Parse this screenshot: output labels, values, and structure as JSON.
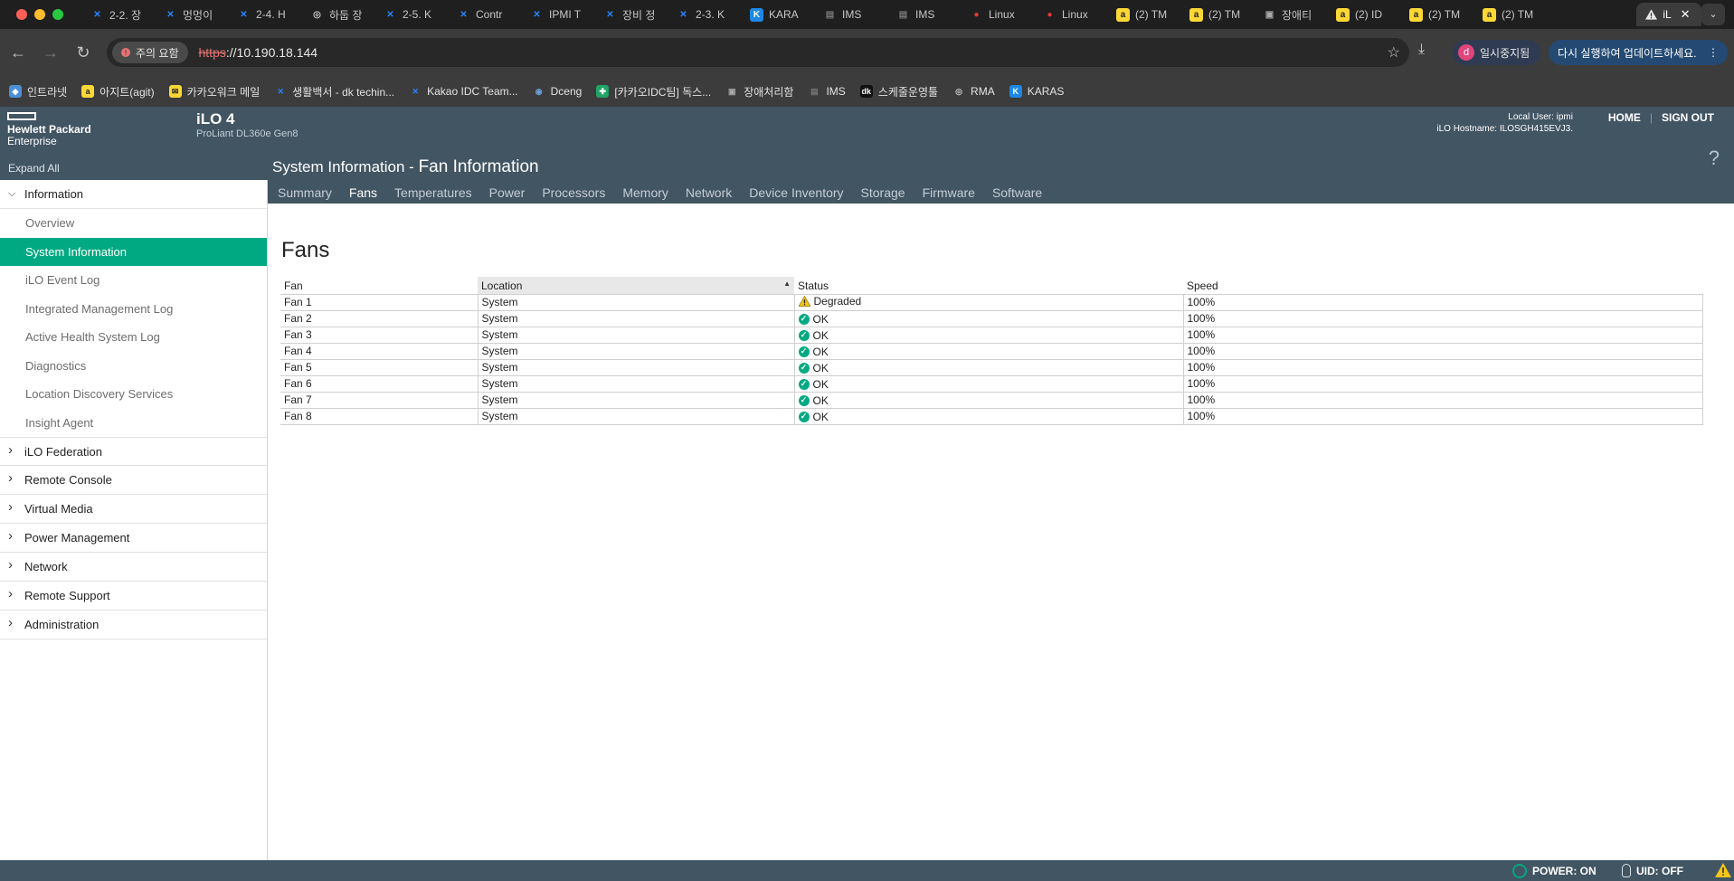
{
  "browser": {
    "tabs": [
      {
        "label": "2-2. 장",
        "icon": "confluence-icon",
        "color": "#2684ff"
      },
      {
        "label": "멍멍이",
        "icon": "confluence-icon",
        "color": "#2684ff"
      },
      {
        "label": "2-4. H",
        "icon": "confluence-icon",
        "color": "#2684ff"
      },
      {
        "label": "하둡 장",
        "icon": "globe-icon",
        "color": "#c7c7c7"
      },
      {
        "label": "2-5. K",
        "icon": "confluence-icon",
        "color": "#2684ff"
      },
      {
        "label": "Contr",
        "icon": "confluence-icon",
        "color": "#2684ff"
      },
      {
        "label": "IPMI T",
        "icon": "confluence-icon",
        "color": "#2684ff"
      },
      {
        "label": "장비 정",
        "icon": "confluence-icon",
        "color": "#2684ff"
      },
      {
        "label": "2-3. K",
        "icon": "confluence-icon",
        "color": "#2684ff"
      },
      {
        "label": "KARA",
        "icon": "k-icon",
        "color": "#1e88e5"
      },
      {
        "label": "IMS",
        "icon": "server-icon",
        "color": "#777"
      },
      {
        "label": "IMS",
        "icon": "server-icon",
        "color": "#777"
      },
      {
        "label": "Linux",
        "icon": "red-circle-icon",
        "color": "#e53935"
      },
      {
        "label": "Linux",
        "icon": "red-circle-icon",
        "color": "#e53935"
      },
      {
        "label": "(2) TM",
        "icon": "agit-icon",
        "color": "#fdd835"
      },
      {
        "label": "(2) TM",
        "icon": "agit-icon",
        "color": "#fdd835"
      },
      {
        "label": "장애티",
        "icon": "doc-icon",
        "color": "#aaa"
      },
      {
        "label": "(2) ID",
        "icon": "agit-icon",
        "color": "#fdd835"
      },
      {
        "label": "(2) TM",
        "icon": "agit-icon",
        "color": "#fdd835"
      },
      {
        "label": "(2) TM",
        "icon": "agit-icon",
        "color": "#fdd835"
      }
    ],
    "active_tab_label": "iL",
    "security_chip": "주의 요함",
    "url_protocol": "https",
    "url_rest": "://10.190.18.144",
    "profile_initial": "d",
    "profile_label": "일시중지됨",
    "update_label": "다시 실행하여 업데이트하세요.",
    "bookmarks": [
      {
        "label": "인트라넷",
        "icon": "intranet-icon",
        "color": "#4a8fd8"
      },
      {
        "label": "아지트(agit)",
        "icon": "agit-icon",
        "color": "#fdd835"
      },
      {
        "label": "카카오워크 메일",
        "icon": "mail-icon",
        "color": "#fdd835"
      },
      {
        "label": "생활백서 - dk techin...",
        "icon": "confluence-icon",
        "color": "#2684ff"
      },
      {
        "label": "Kakao IDC Team...",
        "icon": "confluence-icon",
        "color": "#2684ff"
      },
      {
        "label": "Dceng",
        "icon": "dceng-icon",
        "color": "#6aa0d8"
      },
      {
        "label": "[카카오IDC팀] 독스...",
        "icon": "sheets-icon",
        "color": "#21a366"
      },
      {
        "label": "장애처리함",
        "icon": "doc-icon",
        "color": "#aaa"
      },
      {
        "label": "IMS",
        "icon": "server-icon",
        "color": "#777"
      },
      {
        "label": "스케줄운영툴",
        "icon": "dk-icon",
        "color": "#111"
      },
      {
        "label": "RMA",
        "icon": "globe-icon",
        "color": "#c7c7c7"
      },
      {
        "label": "KARAS",
        "icon": "k-icon",
        "color": "#1e88e5"
      }
    ]
  },
  "ilo": {
    "brand_line1": "Hewlett Packard",
    "brand_line2": "Enterprise",
    "title": "iLO 4",
    "model": "ProLiant DL360e Gen8",
    "local_user": "Local User: ipmi",
    "hostname": "iLO Hostname: ILOSGH415EVJ3.",
    "home": "HOME",
    "sign_out": "SIGN OUT",
    "expand_all": "Expand All",
    "heading_prefix": "System Information - ",
    "heading_main": "Fan Information",
    "help": "?",
    "subtabs": [
      "Summary",
      "Fans",
      "Temperatures",
      "Power",
      "Processors",
      "Memory",
      "Network",
      "Device Inventory",
      "Storage",
      "Firmware",
      "Software"
    ],
    "active_subtab": "Fans"
  },
  "sidebar": {
    "information_label": "Information",
    "information_items": [
      "Overview",
      "System Information",
      "iLO Event Log",
      "Integrated Management Log",
      "Active Health System Log",
      "Diagnostics",
      "Location Discovery Services",
      "Insight Agent"
    ],
    "active_item": "System Information",
    "sections": [
      "iLO Federation",
      "Remote Console",
      "Virtual Media",
      "Power Management",
      "Network",
      "Remote Support",
      "Administration"
    ]
  },
  "fans": {
    "title": "Fans",
    "columns": [
      "Fan",
      "Location",
      "Status",
      "Speed"
    ],
    "sorted_column": "Location",
    "rows": [
      {
        "fan": "Fan 1",
        "location": "System",
        "status": "Degraded",
        "status_kind": "warning",
        "speed": "100%"
      },
      {
        "fan": "Fan 2",
        "location": "System",
        "status": "OK",
        "status_kind": "ok",
        "speed": "100%"
      },
      {
        "fan": "Fan 3",
        "location": "System",
        "status": "OK",
        "status_kind": "ok",
        "speed": "100%"
      },
      {
        "fan": "Fan 4",
        "location": "System",
        "status": "OK",
        "status_kind": "ok",
        "speed": "100%"
      },
      {
        "fan": "Fan 5",
        "location": "System",
        "status": "OK",
        "status_kind": "ok",
        "speed": "100%"
      },
      {
        "fan": "Fan 6",
        "location": "System",
        "status": "OK",
        "status_kind": "ok",
        "speed": "100%"
      },
      {
        "fan": "Fan 7",
        "location": "System",
        "status": "OK",
        "status_kind": "ok",
        "speed": "100%"
      },
      {
        "fan": "Fan 8",
        "location": "System",
        "status": "OK",
        "status_kind": "ok",
        "speed": "100%"
      }
    ]
  },
  "statusbar": {
    "power": "POWER: ON",
    "uid": "UID: OFF"
  },
  "colors": {
    "accent_green": "#01a982",
    "header_slate": "#425563",
    "warning": "#f5c518"
  }
}
